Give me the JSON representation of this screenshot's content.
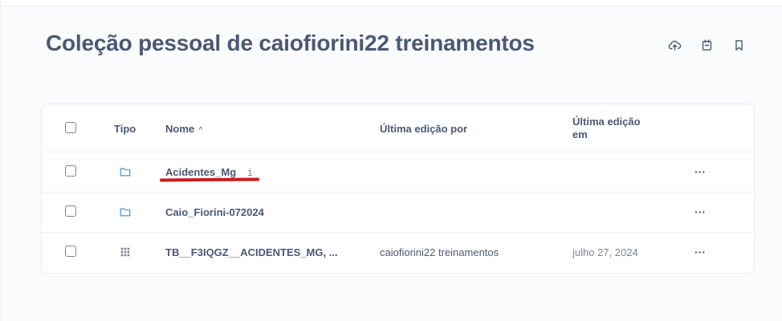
{
  "page": {
    "title": "Coleção pessoal de caiofiorini22 treinamentos"
  },
  "header_actions": [
    {
      "icon": "cloud-upload-icon"
    },
    {
      "icon": "calendar-icon"
    },
    {
      "icon": "bookmark-icon"
    }
  ],
  "table": {
    "columns": {
      "type": "Tipo",
      "name": "Nome",
      "name_sort": "^",
      "last_edited_by": "Última edição por",
      "last_edited_at_line1": "Última edição",
      "last_edited_at_line2": "em"
    },
    "rows": [
      {
        "type_icon": "folder-icon",
        "name": "Acidentes_Mg",
        "name_suffix": "i",
        "last_edited_by": "",
        "last_edited_at": "",
        "more": "···"
      },
      {
        "type_icon": "folder-icon",
        "name": "Caio_Fiorini-072024",
        "last_edited_by": "",
        "last_edited_at": "",
        "more": "···"
      },
      {
        "type_icon": "table-grid-icon",
        "name": "TB__F3IQGZ__ACIDENTES_MG, ...",
        "last_edited_by": "caiofiorini22 treinamentos",
        "last_edited_at": "julho 27, 2024",
        "more": "···"
      }
    ]
  },
  "colors": {
    "text": "#4c5773",
    "folder": "#509ee3",
    "annotation": "#cc1b1b"
  }
}
